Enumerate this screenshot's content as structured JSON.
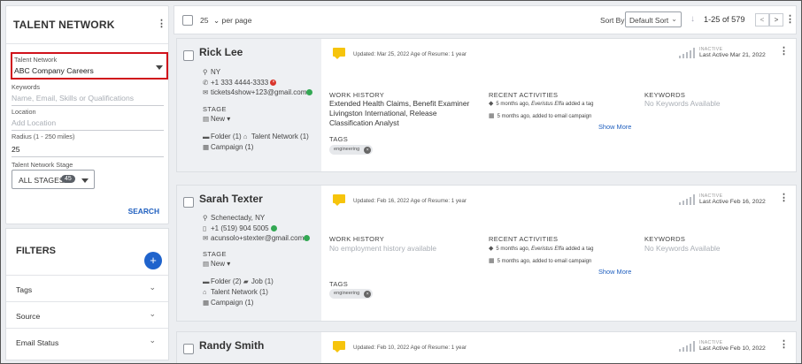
{
  "sidebar": {
    "title": "TALENT NETWORK",
    "talent_network": {
      "label": "Talent Network",
      "value": "ABC Company Careers"
    },
    "keywords": {
      "label": "Keywords",
      "placeholder": "Name, Email, Skills or Qualifications"
    },
    "location": {
      "label": "Location",
      "placeholder": "Add Location"
    },
    "radius": {
      "label": "Radius (1 - 250 miles)",
      "value": "25"
    },
    "stage": {
      "label": "Talent Network Stage",
      "button": "ALL STAGES",
      "count": "45"
    },
    "search_label": "SEARCH",
    "filters_title": "FILTERS",
    "filters": [
      "Tags",
      "Source",
      "Email Status"
    ]
  },
  "topbar": {
    "per_page": "25",
    "per_page_label": "per page",
    "sort_by_label": "Sort By:",
    "sort_value": "Default Sort",
    "range": "1-25 of 579",
    "prev": "<",
    "next": ">"
  },
  "labels": {
    "stage": "STAGE",
    "stage_value": "New",
    "work_history": "WORK HISTORY",
    "recent_activities": "RECENT ACTIVITIES",
    "keywords": "KEYWORDS",
    "no_keywords": "No Keywords Available",
    "tags": "TAGS",
    "show_more": "Show More",
    "inactive": "INACTIVE"
  },
  "candidates": [
    {
      "name": "Rick Lee",
      "location": "NY",
      "phone": "+1 333 4444-3333",
      "email": "tickets4show+123@gmail.com",
      "folder": "Folder (1)",
      "talent_network": "Talent Network (1)",
      "campaign": "Campaign (1)",
      "updated": "Updated: Mar 25, 2022  Age of Resume: 1 year",
      "last_active": "Last Active Mar 21, 2022",
      "work_history": "Extended Health Claims, Benefit Examiner",
      "work_history_2": "Livingston International, Release",
      "work_history_3": "Classification Analyst",
      "activity_1_pre": "5 months ago, ",
      "activity_1_who": "Everistus Effa",
      "activity_1_post": " added a tag",
      "activity_2": "5 months ago, added to email campaign",
      "tag": "engineering"
    },
    {
      "name": "Sarah Texter",
      "location": "Schenectady, NY",
      "phone": "+1 (519) 904 5005",
      "email": "acunsolo+stexter@gmail.com",
      "folder": "Folder (2)",
      "job": "Job (1)",
      "talent_network": "Talent Network (1)",
      "campaign": "Campaign (1)",
      "updated": "Updated: Feb 16, 2022  Age of Resume: 1 year",
      "last_active": "Last Active Feb 16, 2022",
      "work_history": "No employment history available",
      "activity_1_pre": "5 months ago, ",
      "activity_1_who": "Everistus Effa",
      "activity_1_post": " added a tag",
      "activity_2": "5 months ago, added to email campaign",
      "tag": "engineering"
    },
    {
      "name": "Randy Smith",
      "updated": "Updated: Feb 10, 2022  Age of Resume: 1 year",
      "last_active": "Last Active Feb 10, 2022"
    }
  ]
}
